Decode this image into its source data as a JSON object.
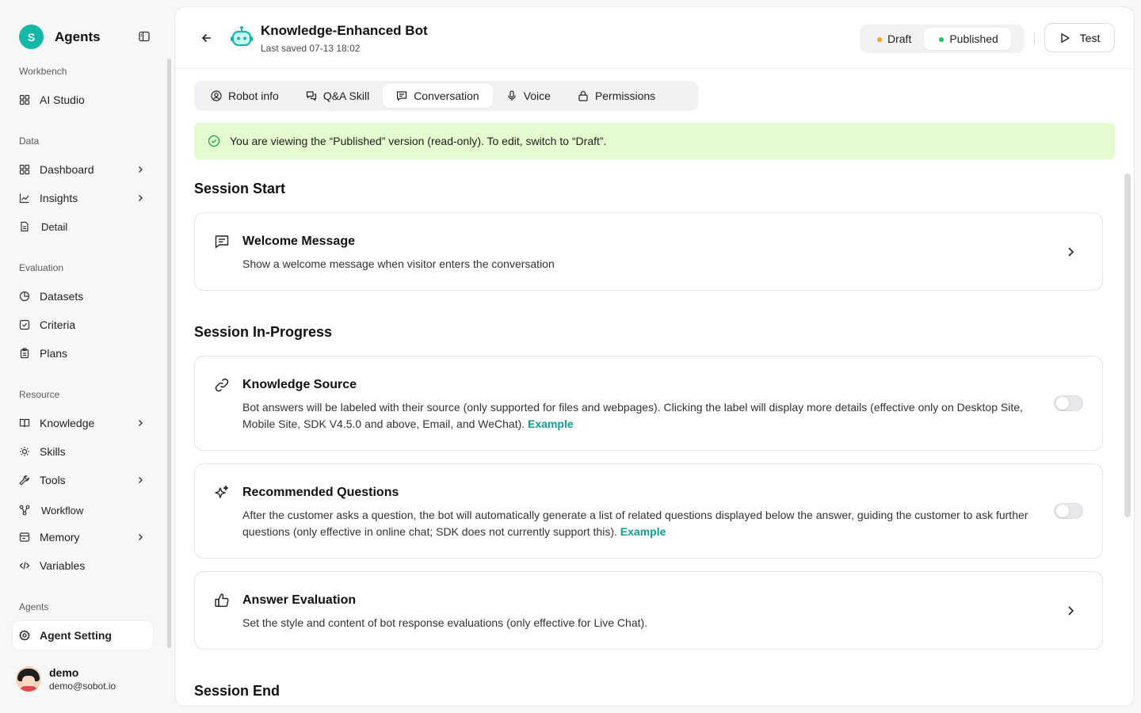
{
  "colors": {
    "accent": "#14b8a6",
    "link": "#0e9f8f",
    "notice_bg": "#e4fbcf",
    "draft_dot": "#f5a524",
    "published_dot": "#22c55e"
  },
  "sidebar": {
    "logo_letter": "S",
    "title": "Agents",
    "groups": {
      "workbench": "Workbench",
      "data": "Data",
      "evaluation": "Evaluation",
      "resource": "Resource",
      "agents": "Agents"
    },
    "items": {
      "ai_studio": "AI Studio",
      "dashboard": "Dashboard",
      "insights": "Insights",
      "detail": "Detail",
      "datasets": "Datasets",
      "criteria": "Criteria",
      "plans": "Plans",
      "knowledge": "Knowledge",
      "skills": "Skills",
      "tools": "Tools",
      "workflow": "Workflow",
      "memory": "Memory",
      "variables": "Variables",
      "agent_setting": "Agent Setting"
    },
    "user": {
      "name": "demo",
      "email": "demo@sobot.io"
    }
  },
  "header": {
    "bot_name": "Knowledge-Enhanced Bot",
    "last_saved": "Last saved 07-13 18:02",
    "versions": {
      "draft": "Draft",
      "published": "Published",
      "selected": "Published"
    },
    "test_label": "Test"
  },
  "tabs": {
    "robot_info": "Robot info",
    "qa_skill": "Q&A Skill",
    "conversation": "Conversation",
    "voice": "Voice",
    "permissions": "Permissions",
    "selected": "Conversation"
  },
  "notice": "You are viewing the “Published” version (read-only). To edit, switch to “Draft”.",
  "sections": {
    "start": "Session Start",
    "in_progress": "Session In-Progress",
    "end": "Session End"
  },
  "cards": {
    "welcome": {
      "title": "Welcome Message",
      "desc": "Show a welcome message when visitor enters the conversation"
    },
    "knowledge_source": {
      "title": "Knowledge Source",
      "desc": "Bot answers will be labeled with their source (only supported for files and webpages). Clicking the label will display more details (effective only on Desktop Site, Mobile Site, SDK V4.5.0 and above, Email, and WeChat).",
      "link": "Example",
      "enabled": false
    },
    "recommended": {
      "title": "Recommended Questions",
      "desc": "After the customer asks a question, the bot will automatically generate a list of related questions displayed below the answer, guiding the customer to ask further questions (only effective in online chat; SDK does not currently support this).",
      "link": "Example",
      "enabled": false
    },
    "evaluation": {
      "title": "Answer Evaluation",
      "desc": "Set the style and content of bot response evaluations (only effective for Live Chat)."
    }
  }
}
